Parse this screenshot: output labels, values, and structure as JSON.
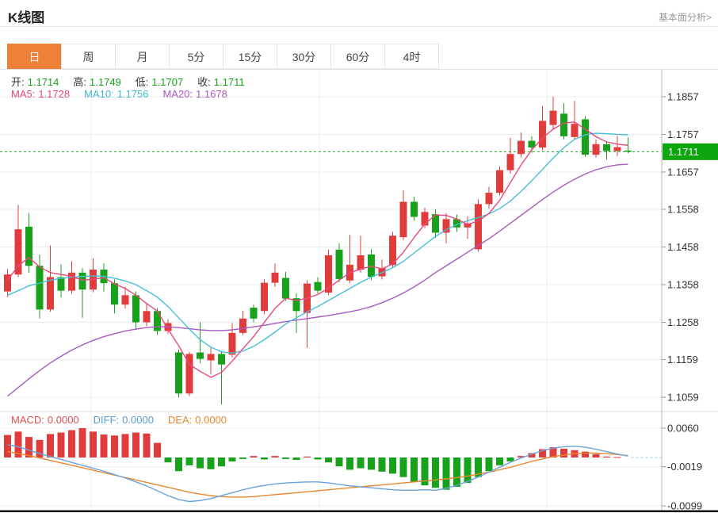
{
  "header": {
    "title": "K线图",
    "link": "基本面分析>"
  },
  "tabs": {
    "active_index": 0,
    "items": [
      "日",
      "周",
      "月",
      "5分",
      "15分",
      "30分",
      "60分",
      "4时"
    ]
  },
  "legend": {
    "ohlc": [
      {
        "label": "开:",
        "value": "1.1714"
      },
      {
        "label": "高:",
        "value": "1.1749"
      },
      {
        "label": "低:",
        "value": "1.1707"
      },
      {
        "label": "收:",
        "value": "1.1711"
      }
    ],
    "ma": [
      {
        "label": "MA5:",
        "value": "1.1728",
        "color": "#e8487e"
      },
      {
        "label": "MA10:",
        "value": "1.1756",
        "color": "#3fb9d3"
      },
      {
        "label": "MA20:",
        "value": "1.1678",
        "color": "#a75ac0"
      }
    ],
    "macd": [
      {
        "label": "MACD:",
        "value": "0.0000",
        "color": "#e05050"
      },
      {
        "label": "DIFF:",
        "value": "0.0000",
        "color": "#5b9bd5"
      },
      {
        "label": "DEA:",
        "value": "0.0000",
        "color": "#e8882f"
      }
    ]
  },
  "colors": {
    "up": "#e03c3c",
    "down": "#18a21c",
    "badge": "#0da60d",
    "dashed_price": "#22a822",
    "ma5": "#e8487e",
    "ma10": "#45c0d8",
    "ma20": "#a75ac0",
    "diff": "#6aa3dc",
    "dea": "#e8882f",
    "zero_dash": "#9cc3ea",
    "label_value": "#18a21c",
    "tab_active": "#ee8137",
    "grid": "#ececec",
    "axis": "#b5b5b5",
    "tick_text": "#333333"
  },
  "chart_data": {
    "type": "candlestick+macd",
    "title": "K线图",
    "price_axis": {
      "labels": [
        1.1857,
        1.1757,
        1.1657,
        1.1558,
        1.1458,
        1.1358,
        1.1258,
        1.1159,
        1.1059
      ],
      "current_price": 1.1711
    },
    "macd_axis": {
      "labels": [
        0.006,
        -0.0019,
        -0.0099
      ]
    },
    "last_candle": {
      "open": 1.1714,
      "high": 1.1749,
      "low": 1.1707,
      "close": 1.1711
    },
    "ma_current": {
      "ma5": 1.1728,
      "ma10": 1.1756,
      "ma20": 1.1678
    },
    "macd_current": {
      "macd": 0.0,
      "diff": 0.0,
      "dea": 0.0
    },
    "legend_position": "top-left",
    "grid": true,
    "candles": [
      [
        1.134,
        1.14,
        1.1325,
        1.1385
      ],
      [
        1.1385,
        1.157,
        1.1378,
        1.1505
      ],
      [
        1.1512,
        1.1548,
        1.139,
        1.1408
      ],
      [
        1.1408,
        1.1438,
        1.1268,
        1.1292
      ],
      [
        1.1292,
        1.1462,
        1.1286,
        1.1378
      ],
      [
        1.1378,
        1.1412,
        1.1324,
        1.1342
      ],
      [
        1.1342,
        1.142,
        1.1334,
        1.139
      ],
      [
        1.139,
        1.1402,
        1.127,
        1.1345
      ],
      [
        1.1345,
        1.1428,
        1.1338,
        1.1398
      ],
      [
        1.1398,
        1.1415,
        1.134,
        1.1362
      ],
      [
        1.1362,
        1.1372,
        1.1282,
        1.1305
      ],
      [
        1.1305,
        1.1352,
        1.1295,
        1.133
      ],
      [
        1.133,
        1.134,
        1.1238,
        1.1258
      ],
      [
        1.1258,
        1.131,
        1.1248,
        1.1288
      ],
      [
        1.1288,
        1.1296,
        1.1225,
        1.1235
      ],
      [
        1.1235,
        1.1266,
        1.1228,
        1.1256
      ],
      [
        1.1178,
        1.1186,
        1.1059,
        1.1069
      ],
      [
        1.1069,
        1.118,
        1.1062,
        1.1174
      ],
      [
        1.1178,
        1.1258,
        1.115,
        1.1161
      ],
      [
        1.1157,
        1.119,
        1.112,
        1.1174
      ],
      [
        1.1174,
        1.1182,
        1.104,
        1.1146
      ],
      [
        1.1172,
        1.1256,
        1.1165,
        1.123
      ],
      [
        1.123,
        1.1288,
        1.1224,
        1.1268
      ],
      [
        1.1297,
        1.1305,
        1.1258,
        1.1268
      ],
      [
        1.1288,
        1.1372,
        1.128,
        1.1363
      ],
      [
        1.1363,
        1.1414,
        1.1352,
        1.139
      ],
      [
        1.1376,
        1.1392,
        1.1315,
        1.1321
      ],
      [
        1.1322,
        1.1335,
        1.123,
        1.1288
      ],
      [
        1.1283,
        1.137,
        1.119,
        1.1361
      ],
      [
        1.1365,
        1.1378,
        1.1335,
        1.1342
      ],
      [
        1.1337,
        1.1451,
        1.133,
        1.1436
      ],
      [
        1.1451,
        1.1468,
        1.1365,
        1.1373
      ],
      [
        1.1369,
        1.149,
        1.1362,
        1.1411
      ],
      [
        1.1398,
        1.1488,
        1.139,
        1.1436
      ],
      [
        1.1438,
        1.1452,
        1.137,
        1.1379
      ],
      [
        1.138,
        1.1425,
        1.1372,
        1.1402
      ],
      [
        1.141,
        1.1498,
        1.1402,
        1.1488
      ],
      [
        1.1484,
        1.1608,
        1.1476,
        1.1578
      ],
      [
        1.1578,
        1.1592,
        1.1528,
        1.1538
      ],
      [
        1.1515,
        1.1562,
        1.1508,
        1.1551
      ],
      [
        1.1545,
        1.1558,
        1.1482,
        1.1496
      ],
      [
        1.1496,
        1.1548,
        1.1468,
        1.1532
      ],
      [
        1.1532,
        1.1544,
        1.1498,
        1.151
      ],
      [
        1.151,
        1.154,
        1.148,
        1.1521
      ],
      [
        1.1452,
        1.1585,
        1.1446,
        1.1572
      ],
      [
        1.1572,
        1.1618,
        1.156,
        1.1602
      ],
      [
        1.1602,
        1.1672,
        1.1595,
        1.1662
      ],
      [
        1.1662,
        1.1748,
        1.1652,
        1.1705
      ],
      [
        1.1705,
        1.1762,
        1.1696,
        1.174
      ],
      [
        1.174,
        1.1752,
        1.1708,
        1.1722
      ],
      [
        1.1722,
        1.1832,
        1.1715,
        1.1793
      ],
      [
        1.1782,
        1.1857,
        1.177,
        1.182
      ],
      [
        1.1812,
        1.184,
        1.1744,
        1.1752
      ],
      [
        1.175,
        1.1846,
        1.1742,
        1.1785
      ],
      [
        1.1797,
        1.1806,
        1.1697,
        1.1703
      ],
      [
        1.1703,
        1.1743,
        1.1695,
        1.1731
      ],
      [
        1.1731,
        1.1739,
        1.169,
        1.1713
      ],
      [
        1.1713,
        1.1753,
        1.1699,
        1.1723
      ],
      [
        1.1714,
        1.1749,
        1.1707,
        1.1711
      ]
    ],
    "ma5": [
      1.137,
      1.1408,
      1.143,
      1.1405,
      1.139,
      1.1385,
      1.138,
      1.137,
      1.1372,
      1.1377,
      1.136,
      1.1348,
      1.133,
      1.1308,
      1.1288,
      1.124,
      1.1196,
      1.1146,
      1.1128,
      1.1112,
      1.1125,
      1.1155,
      1.1188,
      1.122,
      1.1258,
      1.1295,
      1.1322,
      1.1316,
      1.1322,
      1.1332,
      1.1349,
      1.137,
      1.139,
      1.1399,
      1.1407,
      1.14,
      1.1413,
      1.1444,
      1.1483,
      1.1519,
      1.1543,
      1.1542,
      1.1532,
      1.1518,
      1.1527,
      1.1547,
      1.1582,
      1.1629,
      1.1676,
      1.1716,
      1.1747,
      1.1771,
      1.1787,
      1.179,
      1.1771,
      1.1751,
      1.1737,
      1.1731,
      1.1728
    ],
    "ma10": [
      1.133,
      1.1342,
      1.1355,
      1.1362,
      1.137,
      1.1375,
      1.1378,
      1.138,
      1.1381,
      1.138,
      1.1375,
      1.1368,
      1.1358,
      1.1342,
      1.1325,
      1.13,
      1.127,
      1.124,
      1.1212,
      1.1192,
      1.118,
      1.1176,
      1.1182,
      1.1194,
      1.1212,
      1.1232,
      1.1254,
      1.127,
      1.1286,
      1.13,
      1.1316,
      1.1332,
      1.1348,
      1.1364,
      1.1378,
      1.139,
      1.1403,
      1.142,
      1.1442,
      1.1464,
      1.1486,
      1.1504,
      1.1518,
      1.1528,
      1.1536,
      1.1546,
      1.156,
      1.158,
      1.1606,
      1.1634,
      1.1664,
      1.1694,
      1.1722,
      1.1744,
      1.1756,
      1.176,
      1.1759,
      1.1757,
      1.1756
    ],
    "ma20": [
      1.1062,
      1.1085,
      1.1108,
      1.113,
      1.115,
      1.1168,
      1.1184,
      1.1198,
      1.121,
      1.122,
      1.1228,
      1.1235,
      1.124,
      1.1244,
      1.1246,
      1.1246,
      1.1244,
      1.1241,
      1.1238,
      1.1236,
      1.1236,
      1.1238,
      1.1242,
      1.1246,
      1.125,
      1.1255,
      1.126,
      1.1264,
      1.1268,
      1.1272,
      1.1276,
      1.1281,
      1.1286,
      1.1292,
      1.13,
      1.131,
      1.1322,
      1.1336,
      1.1352,
      1.137,
      1.139,
      1.1408,
      1.1426,
      1.1444,
      1.1462,
      1.148,
      1.15,
      1.1521,
      1.1542,
      1.1563,
      1.1584,
      1.1604,
      1.1622,
      1.1638,
      1.1652,
      1.1663,
      1.1671,
      1.1676,
      1.1678
    ],
    "macd": {
      "hist": [
        0.0046,
        0.0053,
        0.0042,
        0.0036,
        0.0048,
        0.0051,
        0.0056,
        0.006,
        0.0053,
        0.0047,
        0.0045,
        0.0048,
        0.0051,
        0.0049,
        0.003,
        -0.001,
        -0.0028,
        -0.0016,
        -0.0022,
        -0.0024,
        -0.0018,
        -0.0008,
        -0.0003,
        0.0003,
        -0.0004,
        0.0003,
        -0.0003,
        -0.0005,
        0.0002,
        -0.0004,
        -0.001,
        -0.0018,
        -0.0025,
        -0.0022,
        -0.0025,
        -0.0029,
        -0.0033,
        -0.004,
        -0.005,
        -0.0057,
        -0.0062,
        -0.0066,
        -0.006,
        -0.0052,
        -0.004,
        -0.0028,
        -0.0016,
        -0.0008,
        0.0003,
        0.0009,
        0.0017,
        0.0021,
        0.0018,
        0.0015,
        0.0012,
        0.0007,
        0.0002,
        0.0001,
        0.0
      ],
      "diff": [
        0.0026,
        0.0022,
        0.0015,
        0.0008,
        0.0002,
        -0.0004,
        -0.001,
        -0.0016,
        -0.0022,
        -0.0028,
        -0.0035,
        -0.0042,
        -0.005,
        -0.0058,
        -0.0068,
        -0.0078,
        -0.0086,
        -0.009,
        -0.0088,
        -0.0084,
        -0.0078,
        -0.0072,
        -0.0066,
        -0.0061,
        -0.0057,
        -0.0054,
        -0.0052,
        -0.0051,
        -0.005,
        -0.005,
        -0.0052,
        -0.0055,
        -0.0058,
        -0.006,
        -0.0062,
        -0.0064,
        -0.0066,
        -0.0067,
        -0.0067,
        -0.0066,
        -0.0067,
        -0.0063,
        -0.0057,
        -0.0049,
        -0.004,
        -0.003,
        -0.002,
        -0.001,
        -0.0001,
        0.0007,
        0.0014,
        0.0019,
        0.0022,
        0.0023,
        0.0021,
        0.0017,
        0.0012,
        0.0007,
        0.0003
      ],
      "dea": [
        0.0012,
        0.0008,
        0.0004,
        -0.0001,
        -0.0006,
        -0.0011,
        -0.0016,
        -0.0021,
        -0.0026,
        -0.0031,
        -0.0036,
        -0.0041,
        -0.0046,
        -0.0051,
        -0.0056,
        -0.0061,
        -0.0066,
        -0.0071,
        -0.0075,
        -0.0078,
        -0.008,
        -0.0081,
        -0.0081,
        -0.008,
        -0.0078,
        -0.0076,
        -0.0074,
        -0.0072,
        -0.007,
        -0.0068,
        -0.0066,
        -0.0064,
        -0.0062,
        -0.006,
        -0.0058,
        -0.0056,
        -0.0054,
        -0.0052,
        -0.005,
        -0.0048,
        -0.0046,
        -0.0044,
        -0.0041,
        -0.0038,
        -0.0034,
        -0.003,
        -0.0025,
        -0.002,
        -0.0014,
        -0.0008,
        -0.0003,
        0.0002,
        0.0005,
        0.0008,
        0.0009,
        0.0009,
        0.0008,
        0.0006,
        0.0004
      ]
    }
  }
}
